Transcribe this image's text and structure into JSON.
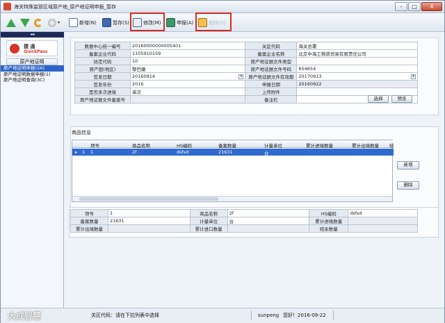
{
  "window": {
    "title": "海关特殊监管区域原产地_原产地证明申报_暂存",
    "btn_min": "-",
    "btn_max": "□",
    "btn_close": "X"
  },
  "toolbar": {
    "new": "新增(N)",
    "save": "暂存(S)",
    "edit": "修改(M)",
    "report": "申报(A)",
    "delete": "删除(D)"
  },
  "sidebar": {
    "collapse": "◂◂",
    "logo_main": "捷 通",
    "logo_sub": "QuickPass",
    "group": "原产地证明",
    "items": [
      {
        "label": "原产地证明申报(2A)",
        "selected": true
      },
      {
        "label": "原产地证明数据申报(1)",
        "selected": false
      },
      {
        "label": "原产地证明查询(3C)",
        "selected": false
      }
    ]
  },
  "form": {
    "labels": {
      "unified_no": "数据中心统一编号",
      "customs_code": "关区代码",
      "filer_code": "备案企业代码",
      "filer_name": "备案企业名称",
      "agreement_code": "协定代码",
      "cert_type": "原产地证据文件类型",
      "origin": "原产国(地区)",
      "cert_no": "原产地证据文件号码",
      "issue_date": "签发日期",
      "valid_date": "原产地证据文件有效期",
      "issue_year": "签发年份",
      "declare_date": "申报日期",
      "multi_entry": "是否多次进境",
      "attachment": "上传附件",
      "record_no": "原产地证据文件备案号",
      "remark": "备注栏"
    },
    "values": {
      "unified_no": "20160000000005401",
      "customs_code": "海关总署",
      "filer_code": "1105910159",
      "filer_name": "北京中海工物资贸易有限责任公司",
      "agreement_code": "10",
      "cert_type": "",
      "origin": "黎巴嫩",
      "cert_no": "654654",
      "issue_date": "20160914",
      "valid_date": "20170913",
      "issue_year": "2016",
      "declare_date": "20160922",
      "multi_entry": "单次",
      "attachment": "",
      "record_no": "",
      "remark": ""
    },
    "btn_select": "选择",
    "btn_preview": "预览"
  },
  "goods": {
    "title": "商品信息",
    "columns": [
      "项号",
      "商品名称",
      "HS编码",
      "备案数量",
      "计量单位",
      "累计进境数量",
      "累计出境数量",
      "结"
    ],
    "rows": [
      {
        "marker": "▸",
        "no": "1",
        "name": "2f",
        "hs": "dsfsd",
        "qty": "21631",
        "unit": "台",
        "cum_in": "",
        "cum_out": ""
      }
    ],
    "btn_add": "新增",
    "btn_delete": "删除"
  },
  "detail": {
    "labels": {
      "item_no": "项号",
      "name": "商品名称",
      "hs": "HS编码",
      "qty": "备案数量",
      "unit": "计量单位",
      "cum_in": "累计进境数量",
      "cum_out": "累计出境数量",
      "cum_import": "累计进口数量",
      "balance": "结余数量"
    },
    "values": {
      "item_no": "1",
      "name": "2f",
      "hs": "dsfsd",
      "qty": "21631",
      "unit": "台",
      "cum_in": "",
      "cum_out": "",
      "cum_import": "",
      "balance": ""
    }
  },
  "status": {
    "hint": "关区代码：请在下拉列表中选择",
    "user": "sunpeng",
    "greeting": "您好！2016-09-22"
  },
  "watermark": "大成智慧"
}
